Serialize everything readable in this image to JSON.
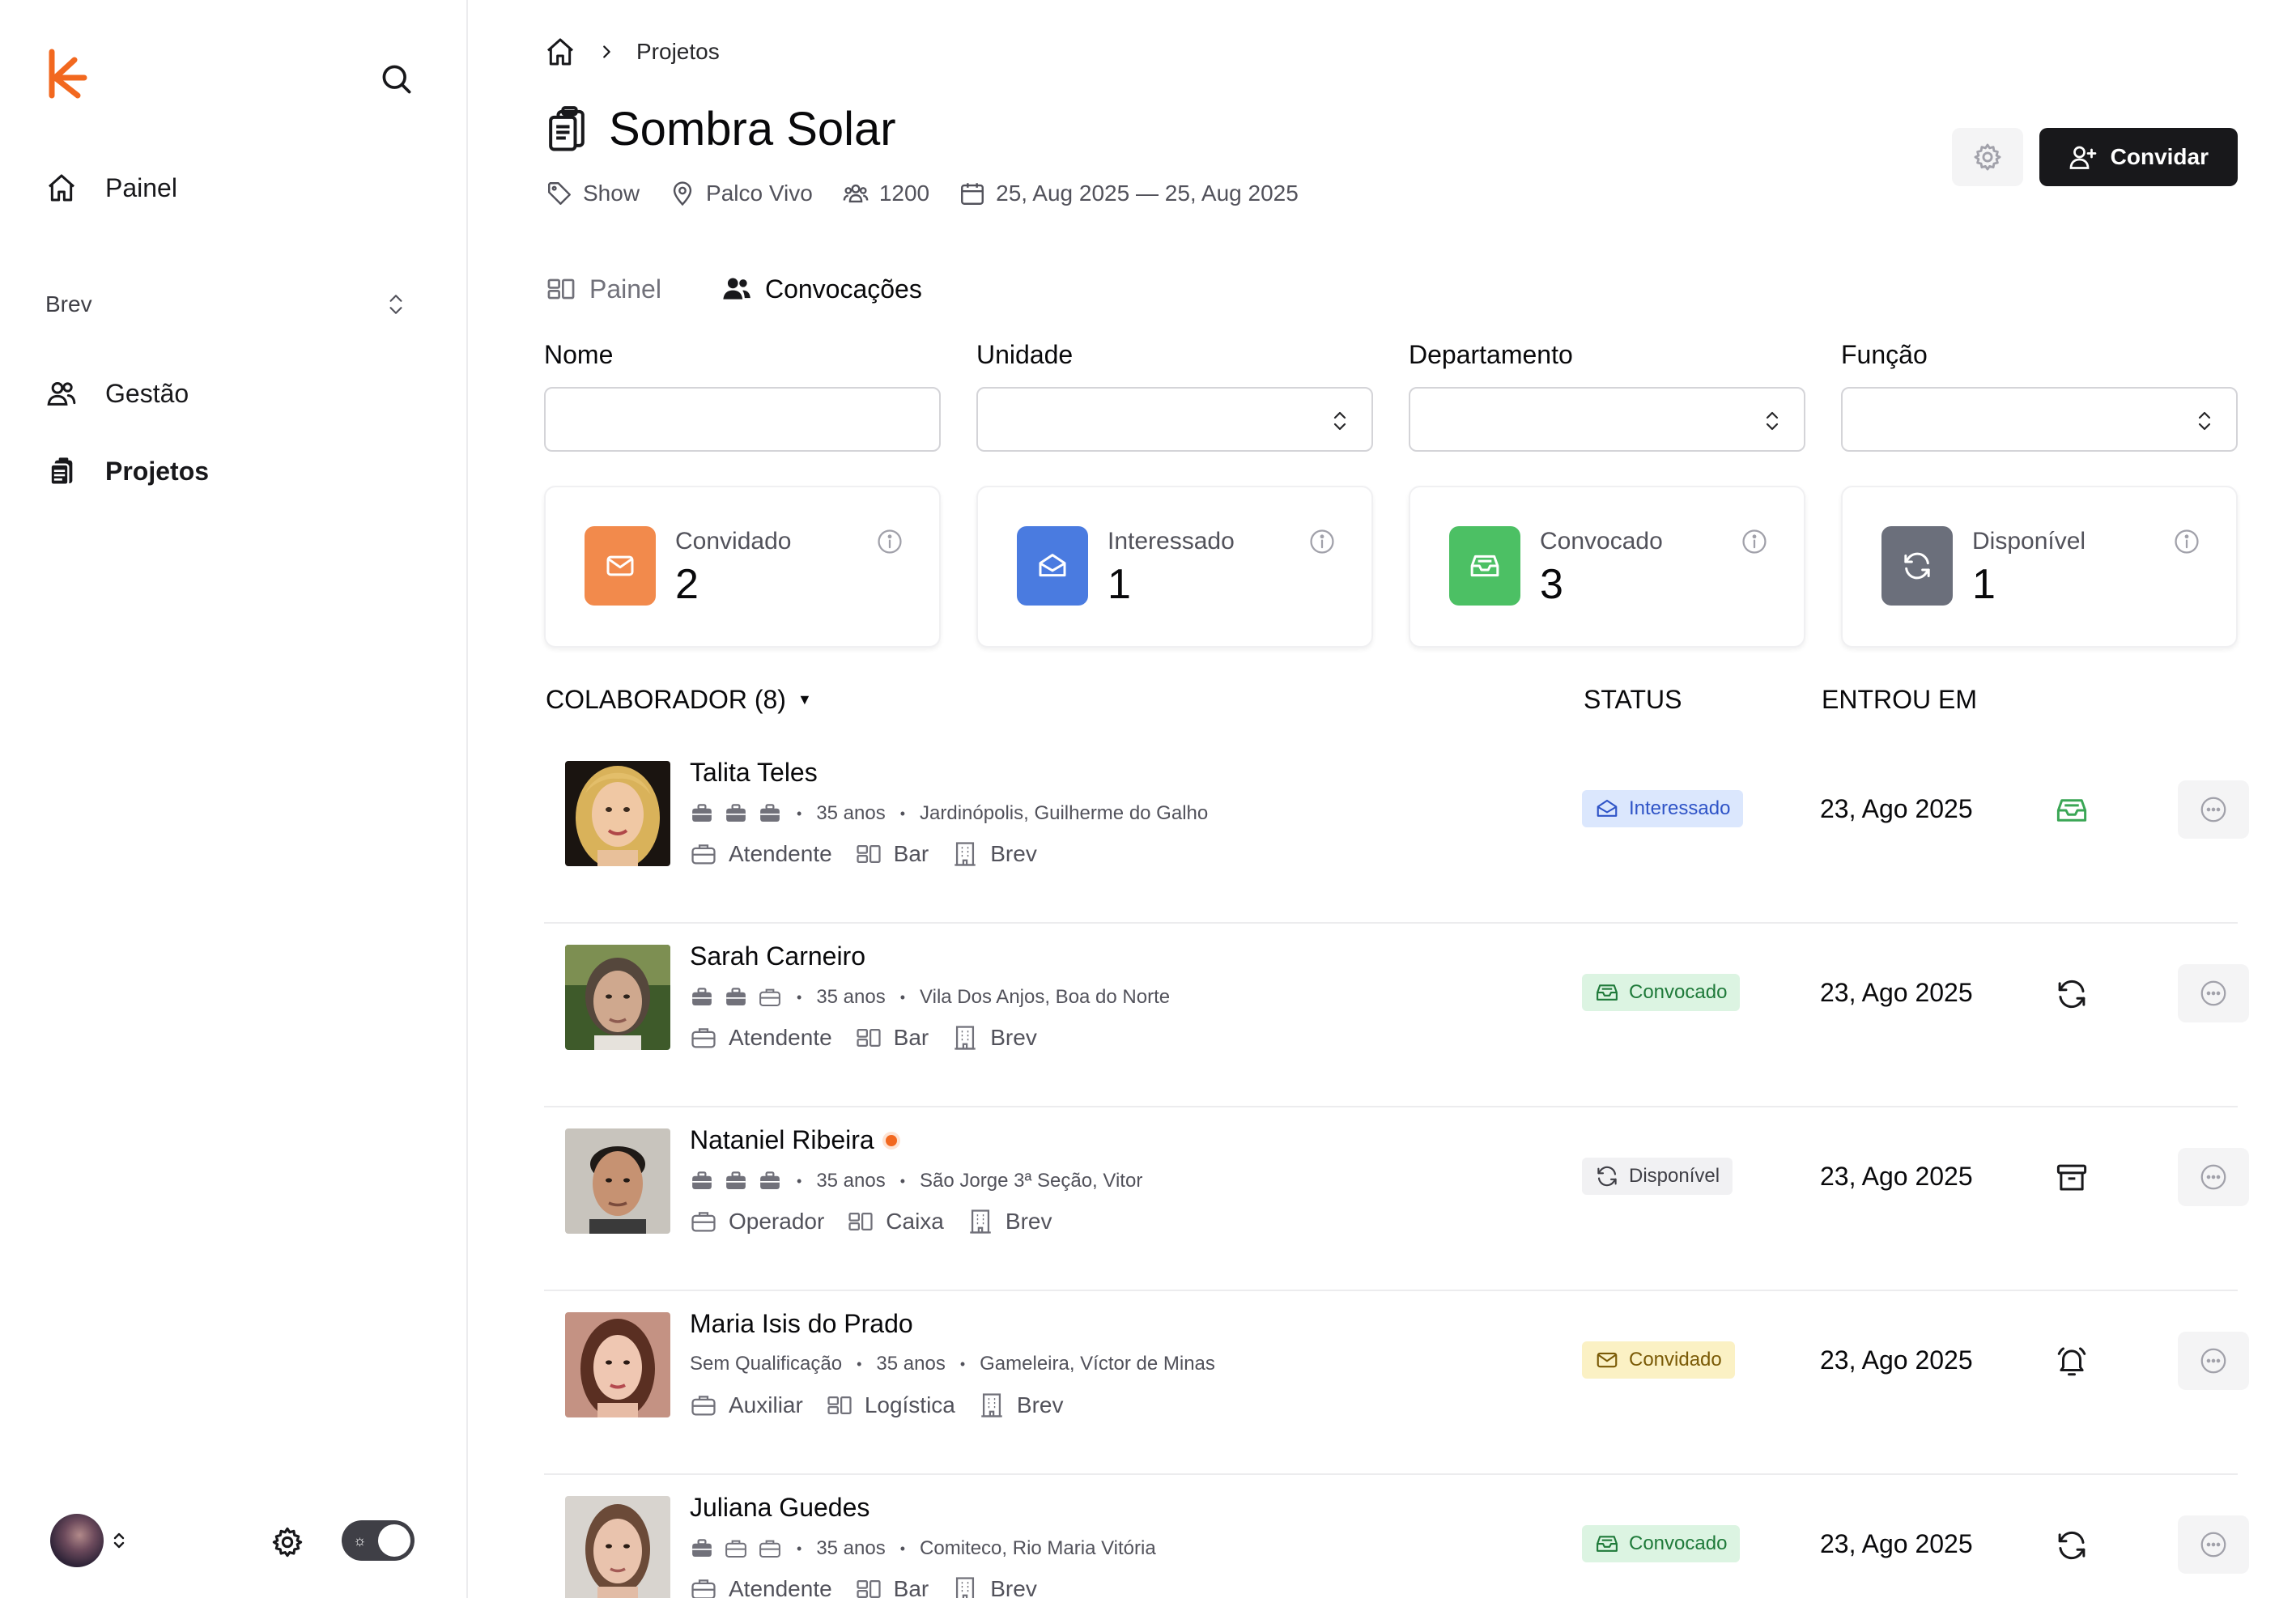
{
  "sidebar": {
    "nav": [
      {
        "label": "Painel"
      },
      {
        "label": "Gestão"
      },
      {
        "label": "Projetos"
      }
    ],
    "org": "Brev"
  },
  "breadcrumb": {
    "current": "Projetos"
  },
  "project": {
    "title": "Sombra Solar",
    "category": "Show",
    "venue": "Palco Vivo",
    "capacity": "1200",
    "dates": "25, Aug 2025 — 25, Aug 2025"
  },
  "actions": {
    "invite_label": "Convidar"
  },
  "tabs": [
    {
      "label": "Painel"
    },
    {
      "label": "Convocações"
    }
  ],
  "filters": [
    {
      "label": "Nome",
      "value": ""
    },
    {
      "label": "Unidade",
      "value": ""
    },
    {
      "label": "Departamento",
      "value": ""
    },
    {
      "label": "Função",
      "value": ""
    }
  ],
  "stats": [
    {
      "label": "Convidado",
      "value": "2",
      "color": "#f28a4c"
    },
    {
      "label": "Interessado",
      "value": "1",
      "color": "#4a7be0"
    },
    {
      "label": "Convocado",
      "value": "3",
      "color": "#4cc064"
    },
    {
      "label": "Disponível",
      "value": "1",
      "color": "#6b6f7b"
    }
  ],
  "list": {
    "col_collaborator": "COLABORADOR (8)",
    "col_status": "STATUS",
    "col_joined": "ENTROU EM",
    "rows": [
      {
        "name": "Talita Teles",
        "age": "35 anos",
        "location": "Jardinópolis, Guilherme do Galho",
        "role": "Atendente",
        "department": "Bar",
        "unit": "Brev",
        "status": "Interessado",
        "joined": "23, Ago 2025"
      },
      {
        "name": "Sarah Carneiro",
        "age": "35 anos",
        "location": "Vila Dos Anjos, Boa do Norte",
        "role": "Atendente",
        "department": "Bar",
        "unit": "Brev",
        "status": "Convocado",
        "joined": "23, Ago 2025"
      },
      {
        "name": "Nataniel Ribeira",
        "age": "35 anos",
        "location": "São Jorge 3ª Seção, Vitor",
        "role": "Operador",
        "department": "Caixa",
        "unit": "Brev",
        "status": "Disponível",
        "joined": "23, Ago 2025"
      },
      {
        "name": "Maria Isis do Prado",
        "qualification": "Sem Qualificação",
        "age": "35 anos",
        "location": "Gameleira, Víctor de Minas",
        "role": "Auxiliar",
        "department": "Logística",
        "unit": "Brev",
        "status": "Convidado",
        "joined": "23, Ago 2025"
      },
      {
        "name": "Juliana Guedes",
        "age": "35 anos",
        "location": "Comiteco, Rio Maria Vitória",
        "role": "Atendente",
        "department": "Bar",
        "unit": "Brev",
        "status": "Convocado",
        "joined": "23, Ago 2025"
      }
    ]
  }
}
